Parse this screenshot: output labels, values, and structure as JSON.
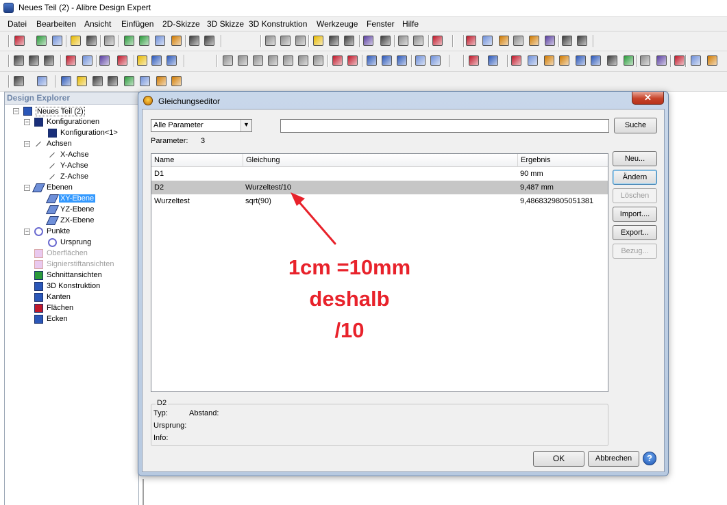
{
  "window": {
    "title": "Neues Teil (2) - Alibre Design Expert"
  },
  "menu": [
    "Datei",
    "Bearbeiten",
    "Ansicht",
    "Einfügen",
    "2D-Skizze",
    "3D Skizze",
    "3D Konstruktion",
    "Werkzeuge",
    "Fenster",
    "Hilfe"
  ],
  "explorer": {
    "title": "Design Explorer",
    "tree": [
      {
        "label": "Neues Teil (2)",
        "icon": "part-icon",
        "toggle": "−"
      },
      {
        "label": "Konfigurationen",
        "icon": "configurations-icon",
        "toggle": "−"
      },
      {
        "label": "Konfiguration<1>",
        "icon": "configuration-icon"
      },
      {
        "label": "Achsen",
        "icon": "axes-icon",
        "toggle": "−"
      },
      {
        "label": "X-Achse",
        "icon": "axis-icon"
      },
      {
        "label": "Y-Achse",
        "icon": "axis-icon"
      },
      {
        "label": "Z-Achse",
        "icon": "axis-icon"
      },
      {
        "label": "Ebenen",
        "icon": "planes-icon",
        "toggle": "−"
      },
      {
        "label": "XY-Ebene",
        "icon": "plane-icon",
        "selected": true
      },
      {
        "label": "YZ-Ebene",
        "icon": "plane-icon"
      },
      {
        "label": "ZX-Ebene",
        "icon": "plane-icon"
      },
      {
        "label": "Punkte",
        "icon": "points-icon",
        "toggle": "−"
      },
      {
        "label": "Ursprung",
        "icon": "origin-icon"
      },
      {
        "label": "Oberflächen",
        "icon": "surfaces-icon",
        "disabled": true
      },
      {
        "label": "Signierstiftansichten",
        "icon": "redline-views-icon",
        "disabled": true
      },
      {
        "label": "Schnittansichten",
        "icon": "section-views-icon"
      },
      {
        "label": "3D Konstruktion",
        "icon": "3d-construction-icon"
      },
      {
        "label": "Kanten",
        "icon": "edges-icon"
      },
      {
        "label": "Flächen",
        "icon": "faces-icon"
      },
      {
        "label": "Ecken",
        "icon": "vertices-icon"
      }
    ]
  },
  "dialog": {
    "title": "Gleichungseditor",
    "close_label": "✕",
    "filter": {
      "selected": "Alle Parameter",
      "arrow": "▼"
    },
    "search_value": "",
    "search_button": "Suche",
    "param_count_label": "Parameter:",
    "param_count": "3",
    "columns": [
      "Name",
      "Gleichung",
      "Ergebnis"
    ],
    "rows": [
      {
        "name": "D1",
        "equation": "",
        "result": "90 mm"
      },
      {
        "name": "D2",
        "equation": "Wurzeltest/10",
        "result": "9,487 mm",
        "selected": true
      },
      {
        "name": "Wurzeltest",
        "equation": "sqrt(90)",
        "result": "9,4868329805051381"
      }
    ],
    "side_buttons": {
      "new": "Neu...",
      "change": "Ändern",
      "delete": "Löschen",
      "import": "Import....",
      "export": "Export...",
      "reference": "Bezug..."
    },
    "details": {
      "legend": "D2",
      "type_label": "Typ:",
      "type_value": "Abstand:",
      "origin_label": "Ursprung:",
      "origin_value": "",
      "info_label": "Info:",
      "info_value": ""
    },
    "ok": "OK",
    "cancel": "Abbrechen",
    "help": "?"
  },
  "annotation": {
    "lines": [
      "1cm =10mm",
      "deshalb",
      "/10"
    ],
    "color": "#e8222b"
  }
}
